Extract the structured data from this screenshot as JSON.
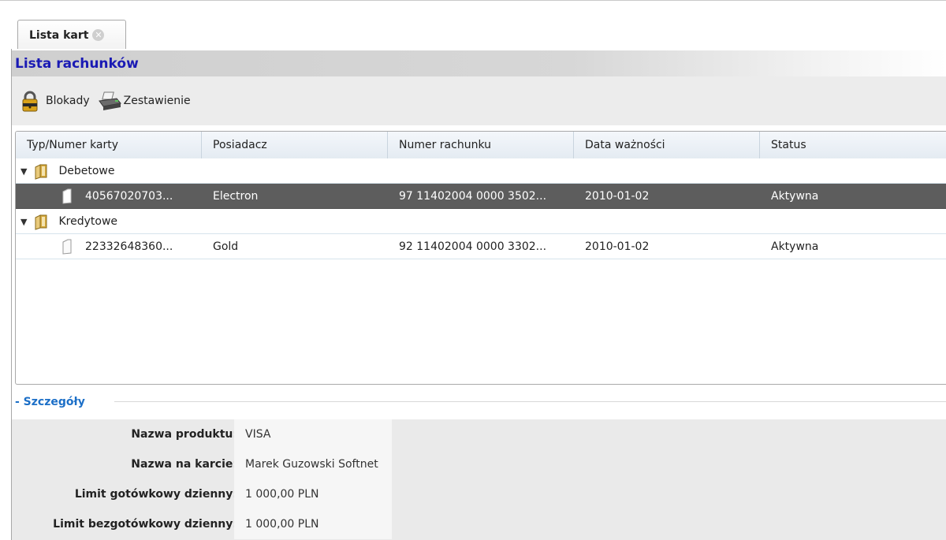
{
  "tab": {
    "label": "Lista kart"
  },
  "panel": {
    "title": "Lista rachunków"
  },
  "toolbar": {
    "blokady_label": "Blokady",
    "zestawienie_label": "Zestawienie"
  },
  "grid": {
    "columns": [
      "Typ/Numer karty",
      "Posiadacz",
      "Numer rachunku",
      "Data ważności",
      "Status"
    ],
    "groups": [
      {
        "label": "Debetowe",
        "rows": [
          {
            "card": "40567020703...",
            "owner": "Electron",
            "account": "97 11402004 0000 3502...",
            "expiry": "2010-01-02",
            "status": "Aktywna"
          }
        ]
      },
      {
        "label": "Kredytowe",
        "rows": [
          {
            "card": "22332648360...",
            "owner": "Gold",
            "account": "92 11402004 0000 3302...",
            "expiry": "2010-01-02",
            "status": "Aktywna"
          }
        ]
      }
    ]
  },
  "details": {
    "title": "- Szczegóły",
    "fields": [
      {
        "label": "Nazwa produktu:",
        "value": "VISA"
      },
      {
        "label": "Nazwa na karcie:",
        "value": "Marek Guzowski Softnet"
      },
      {
        "label": "Limit gotówkowy dzienny:",
        "value": "1 000,00 PLN"
      },
      {
        "label": "Limit bezgotówkowy dzienny:",
        "value": "1 000,00 PLN"
      }
    ]
  },
  "icons": {
    "tab_close": "close-icon",
    "blokady": "lock-icon",
    "zestawienie": "printer-icon",
    "group": "folder-icon",
    "card": "card-icon",
    "expand": "expand-arrow-icon"
  }
}
